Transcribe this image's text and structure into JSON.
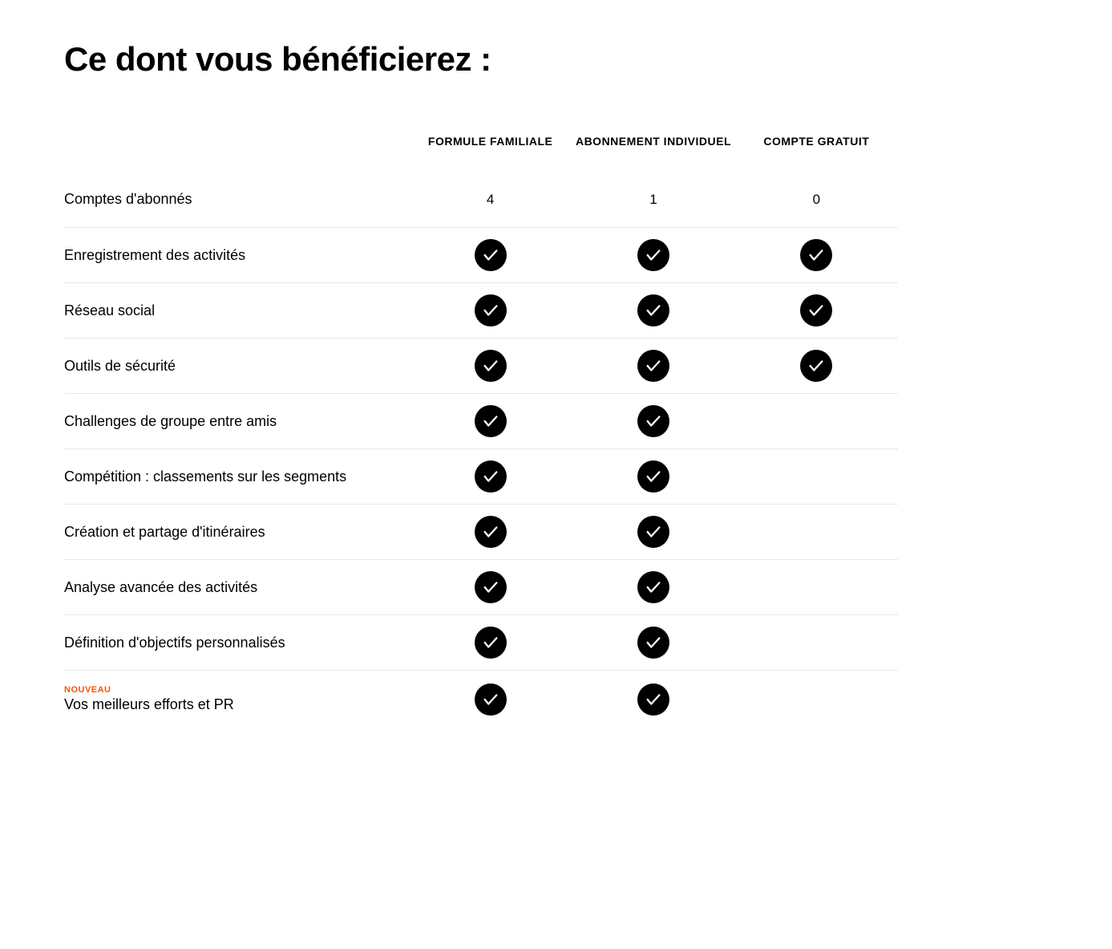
{
  "title": "Ce dont vous bénéficierez :",
  "plans": [
    {
      "label": "FORMULE FAMILIALE"
    },
    {
      "label": "ABONNEMENT INDIVIDUEL"
    },
    {
      "label": "COMPTE GRATUIT"
    }
  ],
  "features": [
    {
      "label": "Comptes d'abonnés",
      "badge": null,
      "values": [
        "4",
        "1",
        "0"
      ],
      "type": "text"
    },
    {
      "label": "Enregistrement des activités",
      "badge": null,
      "values": [
        true,
        true,
        true
      ],
      "type": "check"
    },
    {
      "label": "Réseau social",
      "badge": null,
      "values": [
        true,
        true,
        true
      ],
      "type": "check"
    },
    {
      "label": "Outils de sécurité",
      "badge": null,
      "values": [
        true,
        true,
        true
      ],
      "type": "check"
    },
    {
      "label": "Challenges de groupe entre amis",
      "badge": null,
      "values": [
        true,
        true,
        false
      ],
      "type": "check"
    },
    {
      "label": "Compétition : classements sur les segments",
      "badge": null,
      "values": [
        true,
        true,
        false
      ],
      "type": "check"
    },
    {
      "label": "Création et partage d'itinéraires",
      "badge": null,
      "values": [
        true,
        true,
        false
      ],
      "type": "check"
    },
    {
      "label": "Analyse avancée des activités",
      "badge": null,
      "values": [
        true,
        true,
        false
      ],
      "type": "check"
    },
    {
      "label": "Définition d'objectifs personnalisés",
      "badge": null,
      "values": [
        true,
        true,
        false
      ],
      "type": "check"
    },
    {
      "label": "Vos meilleurs efforts et PR",
      "badge": "NOUVEAU",
      "values": [
        true,
        true,
        false
      ],
      "type": "check"
    }
  ]
}
